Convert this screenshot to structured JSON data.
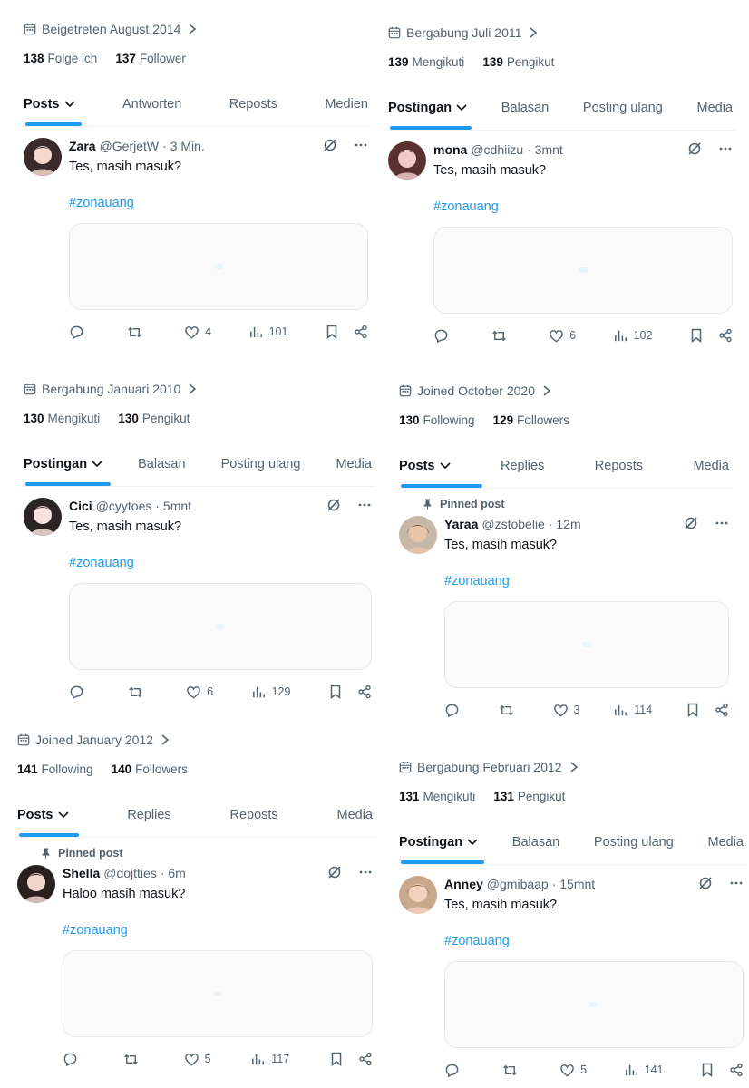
{
  "colors": {
    "accent": "#1d9bf0",
    "muted": "#536471",
    "text": "#0f1419"
  },
  "panels": [
    {
      "joined": "Beigetreten August 2014",
      "following_count": "138",
      "following_label": "Folge ich",
      "followers_count": "137",
      "followers_label": "Follower",
      "tabs": [
        "Posts",
        "Antworten",
        "Reposts",
        "Medien"
      ],
      "pinned_label": "",
      "post": {
        "name": "Zara",
        "handle": "@GerjetW",
        "time": "· 3 Min.",
        "text": "Tes, masih masuk?",
        "hashtag": "#zonauang",
        "reply_count": "",
        "repost_count": "",
        "like_count": "4",
        "view_count": "101"
      }
    },
    {
      "joined": "Bergabung Juli 2011",
      "following_count": "139",
      "following_label": "Mengikuti",
      "followers_count": "139",
      "followers_label": "Pengikut",
      "tabs": [
        "Postingan",
        "Balasan",
        "Posting ulang",
        "Media"
      ],
      "pinned_label": "",
      "post": {
        "name": "mona",
        "handle": "@cdhiizu",
        "time": "· 3mnt",
        "text": "Tes, masih masuk?",
        "hashtag": "#zonauang",
        "reply_count": "",
        "repost_count": "",
        "like_count": "6",
        "view_count": "102"
      }
    },
    {
      "joined": "Bergabung Januari 2010",
      "following_count": "130",
      "following_label": "Mengikuti",
      "followers_count": "130",
      "followers_label": "Pengikut",
      "tabs": [
        "Postingan",
        "Balasan",
        "Posting ulang",
        "Media"
      ],
      "pinned_label": "",
      "post": {
        "name": "Cici",
        "handle": "@cyytoes",
        "time": "· 5mnt",
        "text": "Tes, masih masuk?",
        "hashtag": "#zonauang",
        "reply_count": "",
        "repost_count": "",
        "like_count": "6",
        "view_count": "129"
      }
    },
    {
      "joined": "Joined October 2020",
      "following_count": "130",
      "following_label": "Following",
      "followers_count": "129",
      "followers_label": "Followers",
      "tabs": [
        "Posts",
        "Replies",
        "Reposts",
        "Media"
      ],
      "pinned_label": "Pinned post",
      "post": {
        "name": "Yaraa",
        "handle": "@zstobelie",
        "time": "· 12m",
        "text": "Tes, masih masuk?",
        "hashtag": "#zonauang",
        "reply_count": "",
        "repost_count": "",
        "like_count": "3",
        "view_count": "114"
      }
    },
    {
      "joined": "Joined January 2012",
      "following_count": "141",
      "following_label": "Following",
      "followers_count": "140",
      "followers_label": "Followers",
      "tabs": [
        "Posts",
        "Replies",
        "Reposts",
        "Media"
      ],
      "pinned_label": "Pinned post",
      "post": {
        "name": "Shella",
        "handle": "@dojtties",
        "time": "· 6m",
        "text": "Haloo masih masuk?",
        "hashtag": "#zonauang",
        "reply_count": "",
        "repost_count": "",
        "like_count": "5",
        "view_count": "117"
      }
    },
    {
      "joined": "Bergabung Februari 2012",
      "following_count": "131",
      "following_label": "Mengikuti",
      "followers_count": "131",
      "followers_label": "Pengikut",
      "tabs": [
        "Postingan",
        "Balasan",
        "Posting ulang",
        "Media"
      ],
      "pinned_label": "",
      "post": {
        "name": "Anney",
        "handle": "@gmibaap",
        "time": "· 15mnt",
        "text": "Tes, masih masuk?",
        "hashtag": "#zonauang",
        "reply_count": "",
        "repost_count": "",
        "like_count": "5",
        "view_count": "141"
      }
    }
  ]
}
